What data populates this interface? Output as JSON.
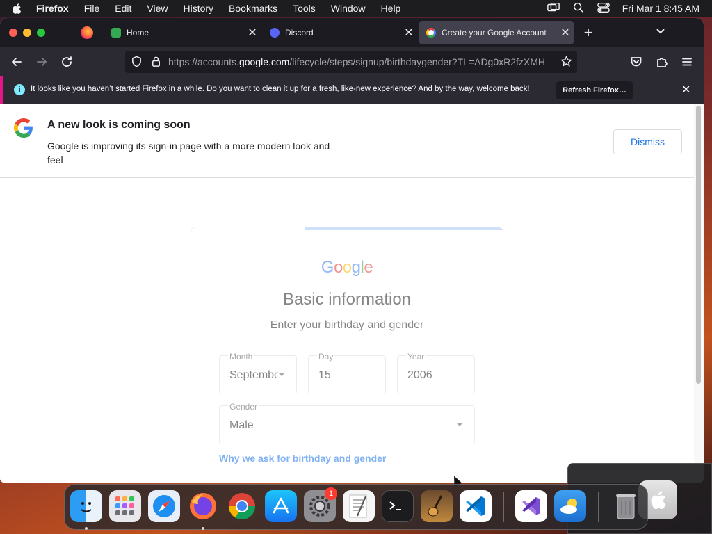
{
  "menubar": {
    "app_name": "Firefox",
    "items": [
      "File",
      "Edit",
      "View",
      "History",
      "Bookmarks",
      "Tools",
      "Window",
      "Help"
    ],
    "clock": "Fri Mar 1  8:45 AM"
  },
  "browser": {
    "tabs": [
      {
        "label": "Home",
        "favicon": "google-sites-icon"
      },
      {
        "label": "Discord",
        "favicon": "discord-icon"
      },
      {
        "label": "Create your Google Account",
        "favicon": "google-icon",
        "active": true
      }
    ],
    "url": {
      "prefix": "https://accounts.",
      "domain": "google.com",
      "path": "/lifecycle/steps/signup/birthdaygender?TL=ADg0xR2fzXMH"
    },
    "notification": {
      "message": "It looks like you haven’t started Firefox in a while. Do you want to clean it up for a fresh, like-new experience? And by the way, welcome back!",
      "button": "Refresh Firefox…"
    }
  },
  "banner": {
    "title": "A new look is coming soon",
    "body": "Google is improving its sign-in page with a more modern look and feel",
    "dismiss": "Dismiss"
  },
  "signup": {
    "logo_text": "Google",
    "title": "Basic information",
    "subtitle": "Enter your birthday and gender",
    "month": {
      "label": "Month",
      "value": "September"
    },
    "day": {
      "label": "Day",
      "value": "15"
    },
    "year": {
      "label": "Year",
      "value": "2006"
    },
    "gender": {
      "label": "Gender",
      "value": "Male"
    },
    "why_link": "Why we ask for birthday and gender"
  },
  "dock": {
    "apps": [
      "Finder",
      "Launchpad",
      "Safari",
      "Firefox",
      "Chrome",
      "App Store",
      "System Settings",
      "TextEdit",
      "Terminal",
      "Instruments",
      "Visual Studio Code",
      "Visual Studio",
      "Weather",
      "Trash"
    ],
    "settings_badge": "1"
  },
  "colors": {
    "accent": "#1a73e8",
    "google_blue": "#4285f4",
    "google_red": "#ea4335",
    "google_yellow": "#fbbc05",
    "google_green": "#34a853",
    "firefox_chrome": "#2b2a33"
  }
}
